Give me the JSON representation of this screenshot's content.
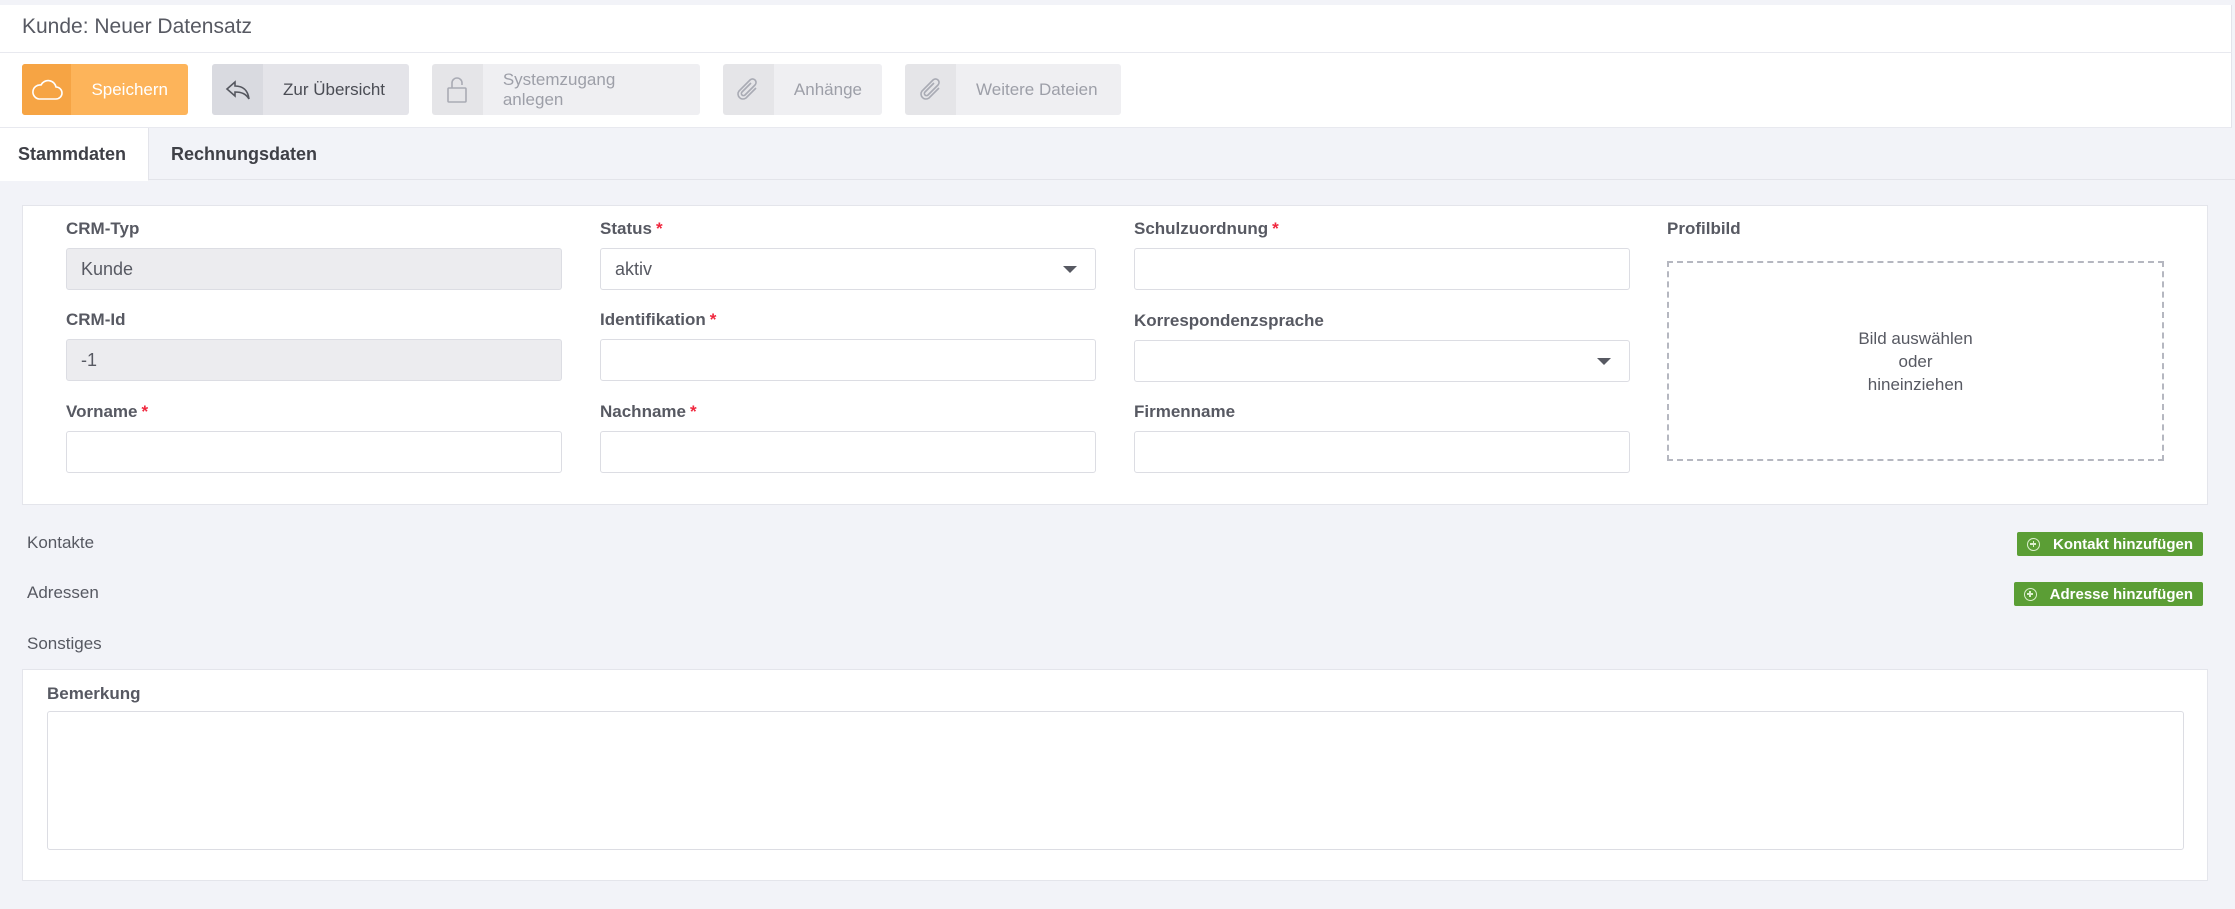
{
  "window": {
    "title": "Kunde: Neuer Datensatz"
  },
  "toolbar": {
    "save_label": "Speichern",
    "overview_label": "Zur Übersicht",
    "system_access_label": "Systemzugang anlegen",
    "attachments_label": "Anhänge",
    "more_files_label": "Weitere Dateien",
    "save_color": "#fdb45a"
  },
  "tabs": [
    {
      "label": "Stammdaten",
      "active": true
    },
    {
      "label": "Rechnungsdaten",
      "active": false
    }
  ],
  "form": {
    "crm_type": {
      "label": "CRM-Typ",
      "value": "Kunde"
    },
    "crm_id": {
      "label": "CRM-Id",
      "value": "-1"
    },
    "first_name": {
      "label": "Vorname",
      "required": "*",
      "value": ""
    },
    "status": {
      "label": "Status",
      "required": "*",
      "value": "aktiv"
    },
    "identification": {
      "label": "Identifikation",
      "required": "*",
      "value": ""
    },
    "last_name": {
      "label": "Nachname",
      "required": "*",
      "value": ""
    },
    "school_assignment": {
      "label": "Schulzuordnung",
      "required": "*",
      "value": ""
    },
    "correspondence_language": {
      "label": "Korrespondenzsprache",
      "value": ""
    },
    "company_name": {
      "label": "Firmenname",
      "value": ""
    },
    "profile_picture": {
      "label": "Profilbild",
      "drop_line1": "Bild auswählen",
      "drop_line2": "oder",
      "drop_line3": "hineinziehen"
    }
  },
  "sections": {
    "contacts": {
      "title": "Kontakte",
      "button": "Kontakt hinzufügen"
    },
    "addresses": {
      "title": "Adressen",
      "button": "Adresse hinzufügen"
    },
    "misc": {
      "title": "Sonstiges",
      "remark_label": "Bemerkung",
      "remark_value": ""
    }
  },
  "colors": {
    "accent_orange": "#fdb45a",
    "add_green": "#5b9e35",
    "required_red": "#f0263d"
  }
}
